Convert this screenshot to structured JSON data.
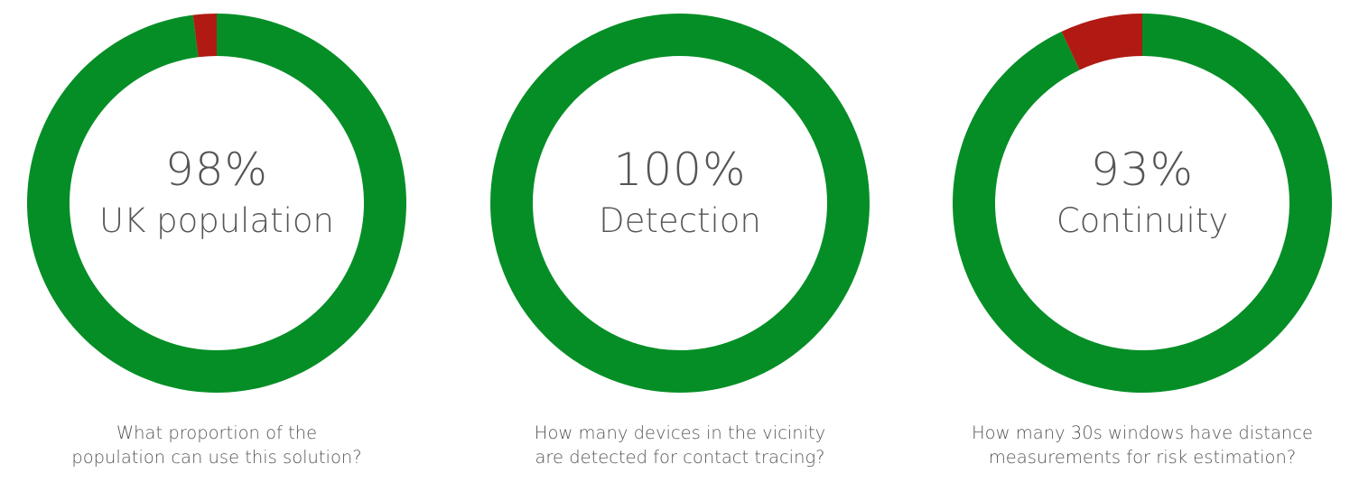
{
  "colors": {
    "good": "#058e26",
    "bad": "#b01a12",
    "text": "#555555"
  },
  "chart_data": [
    {
      "type": "pie",
      "value_label": "98%",
      "center_label": "UK population",
      "caption_lines": [
        "What proportion of the",
        "population can use this solution?"
      ],
      "values": [
        98,
        2
      ]
    },
    {
      "type": "pie",
      "value_label": "100%",
      "center_label": "Detection",
      "caption_lines": [
        "How many devices in the vicinity",
        "are detected for contact tracing?"
      ],
      "values": [
        100,
        0
      ]
    },
    {
      "type": "pie",
      "value_label": "93%",
      "center_label": "Continuity",
      "caption_lines": [
        "How many 30s windows have distance",
        "measurements for risk estimation?"
      ],
      "values": [
        93,
        7
      ]
    }
  ]
}
